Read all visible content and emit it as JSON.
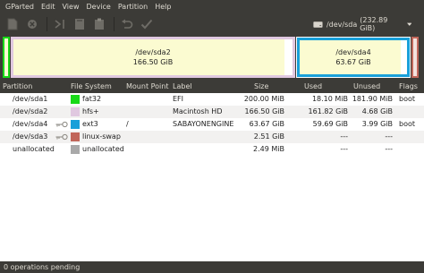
{
  "menu": [
    "GParted",
    "Edit",
    "View",
    "Device",
    "Partition",
    "Help"
  ],
  "toolbar": {
    "buttons": [
      "new-icon",
      "delete-icon",
      "resize-move-icon",
      "copy-icon",
      "paste-icon",
      "undo-icon",
      "apply-icon"
    ]
  },
  "device": {
    "label": "/dev/sda",
    "size": "(232.89 GiB)"
  },
  "map": {
    "sda2": {
      "name": "/dev/sda2",
      "size": "166.50 GiB",
      "used_fraction": 0.97
    },
    "sda4": {
      "name": "/dev/sda4",
      "size": "63.67 GiB",
      "used_fraction": 0.94
    }
  },
  "columns": {
    "partition": "Partition",
    "filesystem": "File System",
    "mount": "Mount Point",
    "label": "Label",
    "size": "Size",
    "used": "Used",
    "unused": "Unused",
    "flags": "Flags"
  },
  "rows": [
    {
      "partition": "/dev/sda1",
      "fs": "fat32",
      "fs_color": "#18d918",
      "mount": "",
      "label": "EFI",
      "size": "200.00 MiB",
      "used": "18.10 MiB",
      "unused": "181.90 MiB",
      "flags": "boot"
    },
    {
      "partition": "/dev/sda2",
      "fs": "hfs+",
      "fs_color": "#e0c8e0",
      "mount": "",
      "label": "Macintosh HD",
      "size": "166.50 GiB",
      "used": "161.82 GiB",
      "unused": "4.68 GiB",
      "flags": ""
    },
    {
      "partition": "/dev/sda4",
      "fs": "ext3",
      "fs_color": "#19a0d9",
      "mount": "/",
      "label": "SABAYONENGINE",
      "size": "63.67 GiB",
      "used": "59.69 GiB",
      "unused": "3.99 GiB",
      "flags": "boot"
    },
    {
      "partition": "/dev/sda3",
      "fs": "linux-swap",
      "fs_color": "#c1665a",
      "mount": "",
      "label": "",
      "size": "2.51 GiB",
      "used": "---",
      "unused": "---",
      "flags": ""
    },
    {
      "partition": "unallocated",
      "fs": "unallocated",
      "fs_color": "#a9a9a9",
      "mount": "",
      "label": "",
      "size": "2.49 MiB",
      "used": "---",
      "unused": "---",
      "flags": ""
    }
  ],
  "status": "0 operations pending"
}
